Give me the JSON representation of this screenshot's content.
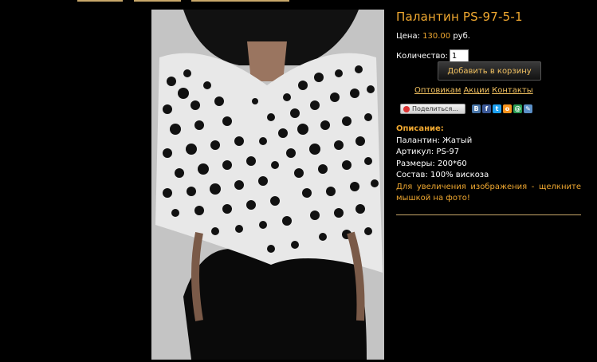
{
  "product": {
    "title": "Палантин PS-97-5-1",
    "price_label": "Цена:",
    "price_value": "130.00",
    "price_unit": "руб.",
    "quantity_label": "Количество:",
    "quantity_value": "1",
    "add_to_cart": "Добавить в корзину"
  },
  "links": [
    "Оптовикам",
    "Акции",
    "Контакты"
  ],
  "share": {
    "button_label": "Поделиться...",
    "icons": [
      "vkontakte-icon",
      "facebook-icon",
      "twitter-icon",
      "odnoklassniki-icon",
      "mail-ru-icon",
      "livejournal-icon"
    ]
  },
  "description": {
    "heading": "Описание:",
    "lines": [
      "Палантин: Жатый",
      "Артикул: PS-97",
      "Размеры: 200*60",
      "Состав: 100% вискоза"
    ],
    "note": "Для увеличения изображения - щелкните мышкой на фото!"
  },
  "colors": {
    "accent": "#f0a830",
    "background": "#000000"
  }
}
